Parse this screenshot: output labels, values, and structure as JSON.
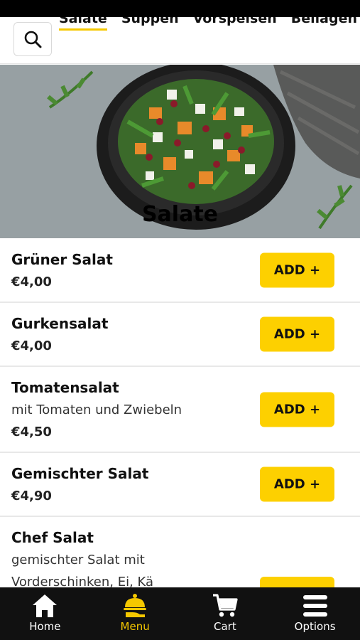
{
  "categories": {
    "tabs": [
      {
        "label": "Salate",
        "active": true
      },
      {
        "label": "Suppen"
      },
      {
        "label": "Vorspeisen"
      },
      {
        "label": "Beilagen ur"
      }
    ]
  },
  "search": {
    "icon": "search-icon"
  },
  "hero": {
    "title": "Salate"
  },
  "items": [
    {
      "name": "Grüner Salat",
      "desc": "",
      "price": "€4,00",
      "button": "ADD +"
    },
    {
      "name": "Gurkensalat",
      "desc": "",
      "price": "€4,00",
      "button": "ADD +"
    },
    {
      "name": "Tomatensalat",
      "desc": "mit Tomaten und Zwiebeln",
      "price": "€4,50",
      "button": "ADD +"
    },
    {
      "name": "Gemischter Salat",
      "desc": "",
      "price": "€4,90",
      "button": "ADD +"
    },
    {
      "name": "Chef Salat",
      "desc": "gemischter Salat mit",
      "desc2": "Vorderschinken, Ei, Kä",
      "price": "",
      "button": "ADD +"
    }
  ],
  "nav": [
    {
      "label": "Home",
      "icon": "home-icon"
    },
    {
      "label": "Menu",
      "icon": "menu-cloche-icon",
      "active": true
    },
    {
      "label": "Cart",
      "icon": "cart-icon"
    },
    {
      "label": "Options",
      "icon": "hamburger-icon"
    }
  ],
  "colors": {
    "accent": "#fdd000",
    "nav_bg": "#111111",
    "active_nav": "#f5c800"
  }
}
